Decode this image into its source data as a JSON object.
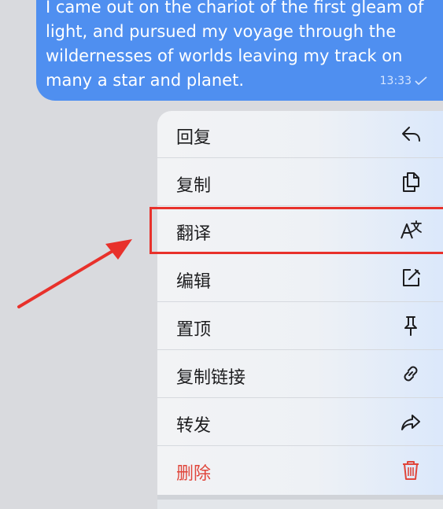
{
  "message": {
    "text": "I came out on the chariot of the first gleam of light, and pursued my voyage through the wildernesses of worlds leaving my track on many a star and planet.",
    "time": "13:33"
  },
  "menu": {
    "items": [
      {
        "label": "回复",
        "icon": "reply-icon"
      },
      {
        "label": "复制",
        "icon": "copy-icon"
      },
      {
        "label": "翻译",
        "icon": "translate-icon"
      },
      {
        "label": "编辑",
        "icon": "edit-icon"
      },
      {
        "label": "置顶",
        "icon": "pin-icon"
      },
      {
        "label": "复制链接",
        "icon": "link-icon"
      },
      {
        "label": "转发",
        "icon": "forward-icon"
      },
      {
        "label": "删除",
        "icon": "trash-icon"
      }
    ]
  },
  "colors": {
    "bubble": "#4f8ff0",
    "danger": "#e0453a",
    "annotation": "#e8312b"
  }
}
